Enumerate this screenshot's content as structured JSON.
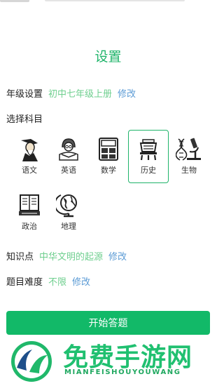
{
  "page": {
    "title": "设置"
  },
  "grade": {
    "label": "年级设置",
    "value": "初中七年级上册",
    "edit": "修改"
  },
  "subjects": {
    "label": "选择科目",
    "items": [
      {
        "name": "语文",
        "selected": false,
        "icon": "scholar-icon"
      },
      {
        "name": "英语",
        "selected": false,
        "icon": "student-icon"
      },
      {
        "name": "数学",
        "selected": false,
        "icon": "calculator-icon"
      },
      {
        "name": "历史",
        "selected": true,
        "icon": "bronze-vessel-icon"
      },
      {
        "name": "生物",
        "selected": false,
        "icon": "microscope-dna-icon"
      },
      {
        "name": "政治",
        "selected": false,
        "icon": "book-icon"
      },
      {
        "name": "地理",
        "selected": false,
        "icon": "globe-icon"
      }
    ]
  },
  "knowledge": {
    "label": "知识点",
    "value": "中华文明的起源",
    "edit": "修改"
  },
  "difficulty": {
    "label": "题目难度",
    "value": "不限",
    "edit": "修改"
  },
  "start_button": "开始答题",
  "watermark": {
    "name": "免费手游网",
    "pinyin": "MIANFEISHOUYOUWANG"
  },
  "colors": {
    "accent": "#1fb46a",
    "link": "#5b9bd5",
    "value": "#6fcf8f",
    "button": "#12b968"
  }
}
